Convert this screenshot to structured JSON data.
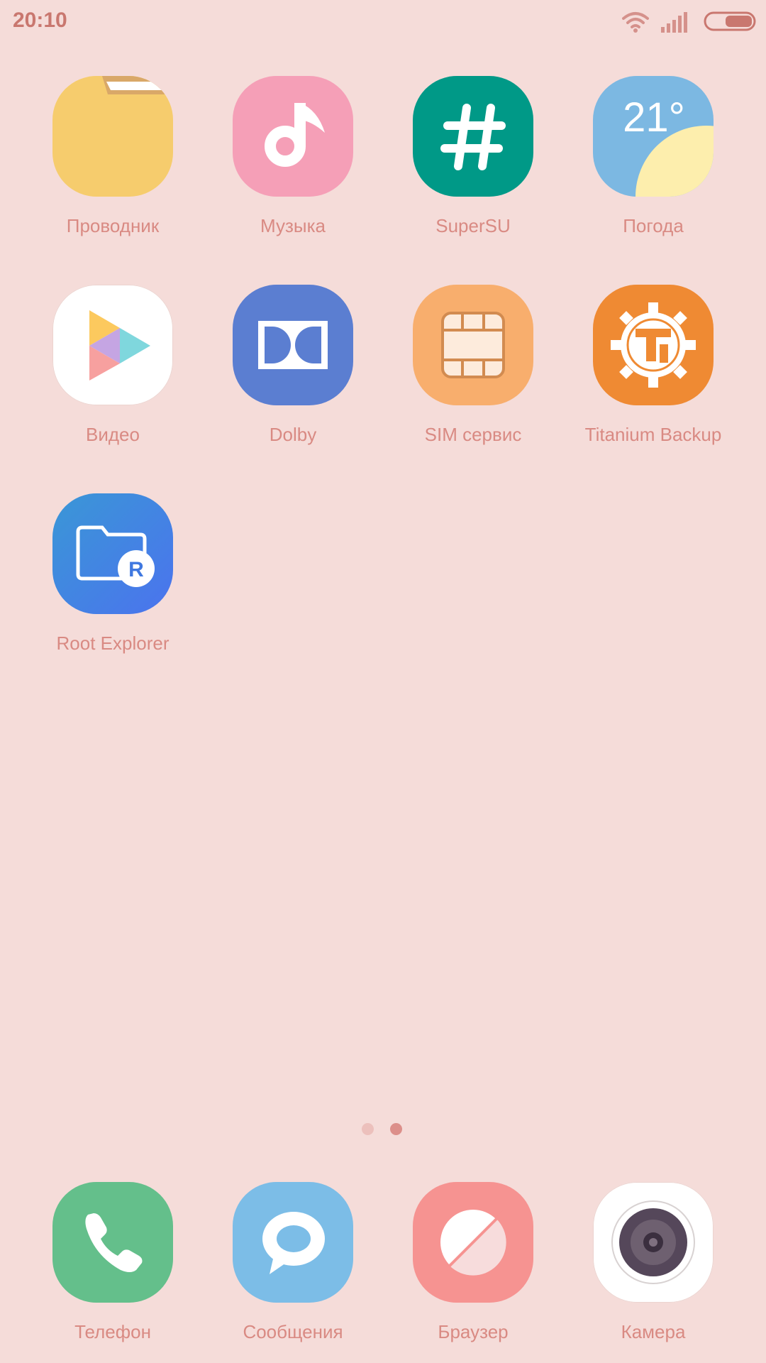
{
  "status_bar": {
    "time": "20:10",
    "icons": [
      "wifi-icon",
      "signal-icon",
      "battery-icon"
    ],
    "text_color": "#c9776f"
  },
  "apps": [
    {
      "label": "Проводник",
      "icon": "folder-icon",
      "color": "#f6cc6d"
    },
    {
      "label": "Музыка",
      "icon": "music-note-icon",
      "color": "#f59fb7"
    },
    {
      "label": "SuperSU",
      "icon": "hash-icon",
      "color": "#009987"
    },
    {
      "label": "Погода",
      "icon": "weather-sun-icon",
      "color": "#7cb8e2",
      "temperature": "21°"
    },
    {
      "label": "Видео",
      "icon": "play-icon",
      "color": "#ffffff"
    },
    {
      "label": "Dolby",
      "icon": "dolby-icon",
      "color": "#5b7ed1"
    },
    {
      "label": "SIM сервис",
      "icon": "sim-chip-icon",
      "color": "#f8ae6d"
    },
    {
      "label": "Titanium Backup",
      "icon": "titanium-gear-icon",
      "color": "#ef8a33"
    },
    {
      "label": "Root Explorer",
      "icon": "root-folder-icon",
      "color": "#3f87de",
      "badge": "R"
    }
  ],
  "page_indicator": {
    "pages": 2,
    "current": 2
  },
  "dock": [
    {
      "label": "Телефон",
      "icon": "phone-icon",
      "color": "#64bf8b"
    },
    {
      "label": "Сообщения",
      "icon": "chat-bubble-icon",
      "color": "#7cbde7"
    },
    {
      "label": "Браузер",
      "icon": "planet-icon",
      "color": "#f69391"
    },
    {
      "label": "Камера",
      "icon": "camera-lens-icon",
      "color": "#ffffff"
    }
  ]
}
